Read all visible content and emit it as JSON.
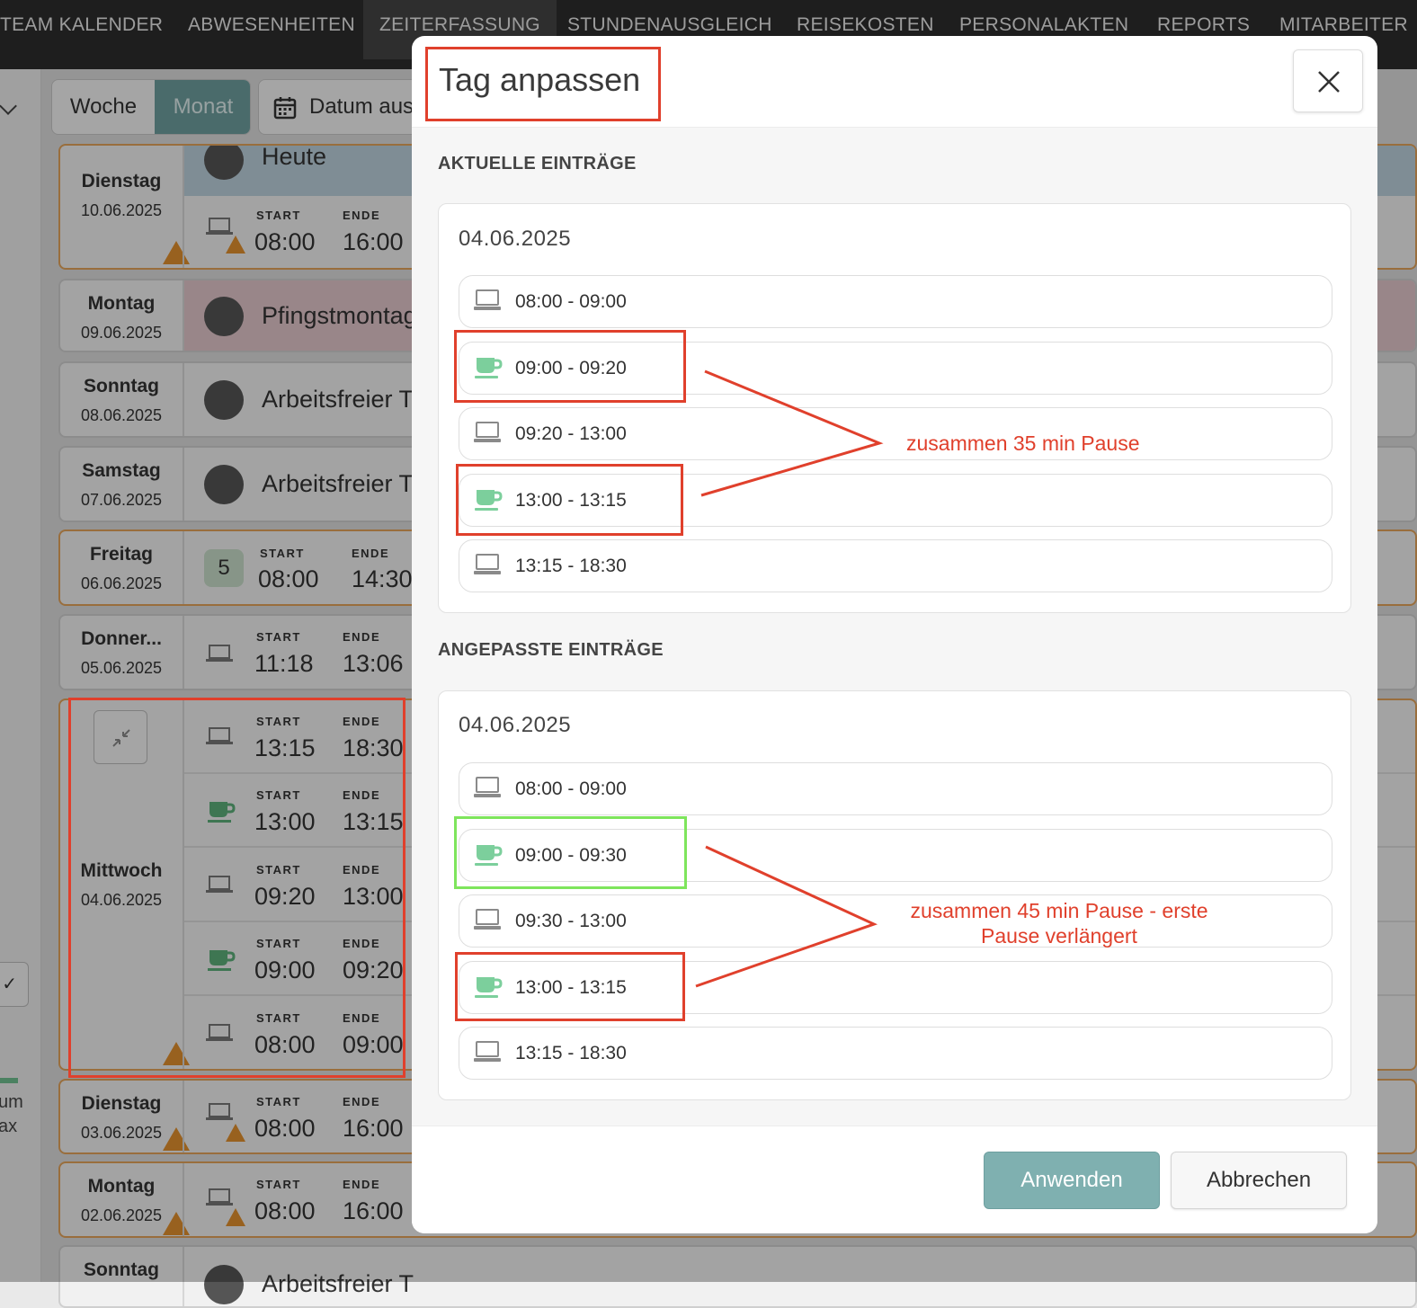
{
  "nav": {
    "items": [
      "TEAM KALENDER",
      "ABWESENHEITEN",
      "ZEITERFASSUNG",
      "STUNDENAUSGLEICH",
      "REISEKOSTEN",
      "PERSONALAKTEN",
      "REPORTS",
      "MITARBEITER"
    ],
    "active": "ZEITERFASSUNG"
  },
  "toolbar": {
    "week": "Woche",
    "month": "Monat",
    "date_pick": "Datum aus"
  },
  "background": {
    "labels": {
      "start": "START",
      "end": "ENDE"
    },
    "rows": [
      {
        "day": "Dienstag",
        "date": "10.06.2025",
        "note": "Heute",
        "start": "08:00",
        "end": "16:00"
      },
      {
        "day": "Montag",
        "date": "09.06.2025",
        "text": "Pfingstmontag"
      },
      {
        "day": "Sonntag",
        "date": "08.06.2025",
        "text": "Arbeitsfreier T"
      },
      {
        "day": "Samstag",
        "date": "07.06.2025",
        "text": "Arbeitsfreier T"
      },
      {
        "day": "Freitag",
        "date": "06.06.2025",
        "badge": "5",
        "start": "08:00",
        "end": "14:30"
      },
      {
        "day": "Donner...",
        "date": "05.06.2025",
        "start": "11:18",
        "end": "13:06"
      },
      {
        "day": "Mittwoch",
        "date": "04.06.2025",
        "entries": [
          {
            "start": "13:15",
            "end": "18:30"
          },
          {
            "start": "13:00",
            "end": "13:15"
          },
          {
            "start": "09:20",
            "end": "13:00"
          },
          {
            "start": "09:00",
            "end": "09:20"
          },
          {
            "start": "08:00",
            "end": "09:00"
          }
        ]
      },
      {
        "day": "Dienstag",
        "date": "03.06.2025",
        "start": "08:00",
        "end": "16:00"
      },
      {
        "day": "Montag",
        "date": "02.06.2025",
        "start": "08:00",
        "end": "16:00"
      },
      {
        "day": "Sonntag",
        "text": "Arbeitsfreier T"
      }
    ],
    "left_fragments": {
      "a": "um",
      "b": "ax"
    }
  },
  "modal": {
    "title": "Tag anpassen",
    "current_section": "AKTUELLE EINTRÄGE",
    "adjusted_section": "ANGEPASSTE EINTRÄGE",
    "current": {
      "date": "04.06.2025",
      "entries": [
        {
          "type": "work",
          "time": "08:00 - 09:00"
        },
        {
          "type": "break",
          "time": "09:00 - 09:20"
        },
        {
          "type": "work",
          "time": "09:20 - 13:00"
        },
        {
          "type": "break",
          "time": "13:00 - 13:15"
        },
        {
          "type": "work",
          "time": "13:15 - 18:30"
        }
      ]
    },
    "adjusted": {
      "date": "04.06.2025",
      "entries": [
        {
          "type": "work",
          "time": "08:00 - 09:00"
        },
        {
          "type": "break",
          "time": "09:00 - 09:30"
        },
        {
          "type": "work",
          "time": "09:30 - 13:00"
        },
        {
          "type": "break",
          "time": "13:00 - 13:15"
        },
        {
          "type": "work",
          "time": "13:15 - 18:30"
        }
      ]
    },
    "apply": "Anwenden",
    "cancel": "Abbrechen"
  },
  "annotations": {
    "note1": "zusammen 35 min Pause",
    "note2_line1": "zusammen 45 min Pause - erste",
    "note2_line2": "Pause verlängert"
  },
  "colors": {
    "break_icon": "#7ccf9c",
    "work_icon": "#8a8a8a",
    "highlight_red": "#e0402c",
    "highlight_green": "#7ee55c",
    "apply_button": "#7fb0b0"
  }
}
